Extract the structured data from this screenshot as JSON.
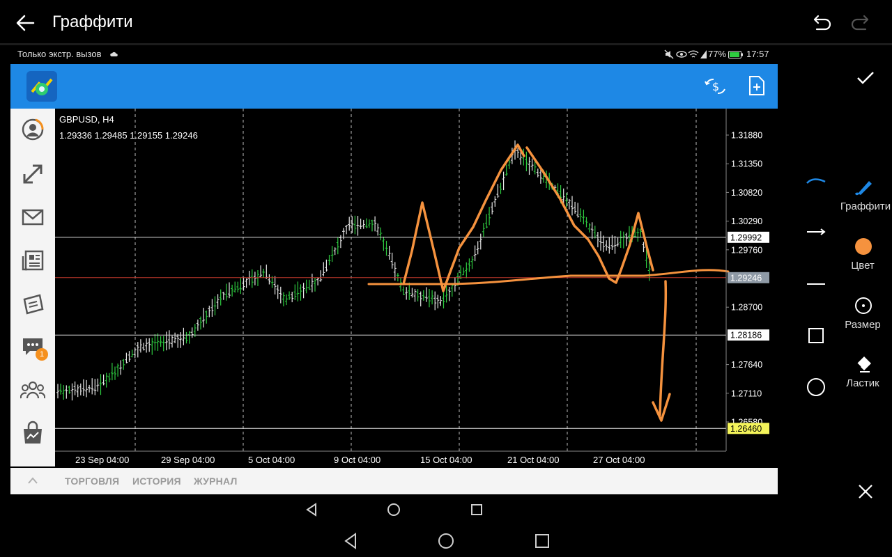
{
  "app": {
    "title": "Граффити"
  },
  "status_bar": {
    "left_text": "Только экстр. вызов",
    "battery": "77%",
    "time": "17:57"
  },
  "chart": {
    "symbol": "GBPUSD, H4",
    "ohlc": "1.29336 1.29485 1.29155 1.29246",
    "price_labels": [
      "1.31880",
      "1.31350",
      "1.30820",
      "1.30290",
      "1.29760",
      "1.28700",
      "1.27640",
      "1.27110",
      "1.26580"
    ],
    "highlighted_levels": [
      {
        "value": "1.29992",
        "style": "white"
      },
      {
        "value": "1.29246",
        "style": "current"
      },
      {
        "value": "1.28186",
        "style": "white"
      },
      {
        "value": "1.26460",
        "style": "yellow"
      }
    ],
    "date_labels": [
      "23 Sep 04:00",
      "29 Sep 04:00",
      "5 Oct 04:00",
      "9 Oct 04:00",
      "15 Oct 04:00",
      "21 Oct 04:00",
      "27 Oct 04:00"
    ]
  },
  "tabs": [
    "ТОРГОВЛЯ",
    "ИСТОРИЯ",
    "ЖУРНАЛ"
  ],
  "sidebar_badge": "1",
  "tools": {
    "graffiti": "Граффити",
    "color": "Цвет",
    "size": "Размер",
    "eraser": "Ластик"
  },
  "colors": {
    "accent": "#1e88e5",
    "drawing": "#f5923e",
    "up_bar": "#2ecc40",
    "bid_line": "#c0392b",
    "yellow_label": "#f4f45a"
  }
}
